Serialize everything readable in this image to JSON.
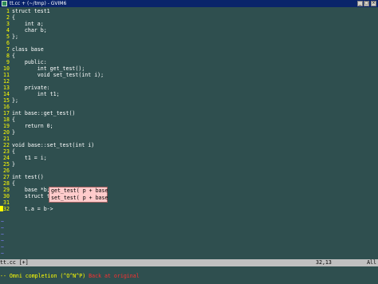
{
  "window": {
    "title": "tt.cc + (~/tmp) - GVIM6"
  },
  "editor": {
    "lines": [
      {
        "n": "1",
        "text": "struct test1"
      },
      {
        "n": "2",
        "text": "{"
      },
      {
        "n": "3",
        "text": "    int a;"
      },
      {
        "n": "4",
        "text": "    char b;"
      },
      {
        "n": "5",
        "text": "};"
      },
      {
        "n": "6",
        "text": ""
      },
      {
        "n": "7",
        "text": "class base"
      },
      {
        "n": "8",
        "text": "{"
      },
      {
        "n": "9",
        "text": "    public:"
      },
      {
        "n": "10",
        "text": "        int get_test();"
      },
      {
        "n": "11",
        "text": "        void set_test(int i);"
      },
      {
        "n": "12",
        "text": ""
      },
      {
        "n": "13",
        "text": "    private:"
      },
      {
        "n": "14",
        "text": "        int t1;"
      },
      {
        "n": "15",
        "text": "};"
      },
      {
        "n": "16",
        "text": ""
      },
      {
        "n": "17",
        "text": "int base::get_test()"
      },
      {
        "n": "18",
        "text": "{"
      },
      {
        "n": "19",
        "text": "    return 0;"
      },
      {
        "n": "20",
        "text": "}"
      },
      {
        "n": "21",
        "text": ""
      },
      {
        "n": "22",
        "text": "void base::set_test(int i)"
      },
      {
        "n": "23",
        "text": "{"
      },
      {
        "n": "24",
        "text": "    t1 = i;"
      },
      {
        "n": "25",
        "text": "}"
      },
      {
        "n": "26",
        "text": ""
      },
      {
        "n": "27",
        "text": "int test()"
      },
      {
        "n": "28",
        "text": "{"
      },
      {
        "n": "29",
        "text": "    base *b;"
      },
      {
        "n": "30",
        "text": "    struct test1 t;"
      },
      {
        "n": "31",
        "text": ""
      },
      {
        "n": "32",
        "text": "    t.a = b->"
      }
    ],
    "tilde": "~"
  },
  "completion_popup": {
    "items": [
      "get_test( p + base",
      "set_test( p + base"
    ]
  },
  "statusline": {
    "filename": "tt.cc [+]",
    "position": "32,13",
    "percent": "All"
  },
  "cmdline": {
    "mode": "-- Omni completion (^O^N^P)",
    "message": "Back at original"
  },
  "colors": {
    "background": "#2f4f4f",
    "line_number": "#ffff00",
    "text": "#ffffff",
    "tilde": "#7f7fff",
    "popup": "#ffcbcb",
    "mode_message": "#ffff00",
    "error_message": "#ff3030"
  }
}
